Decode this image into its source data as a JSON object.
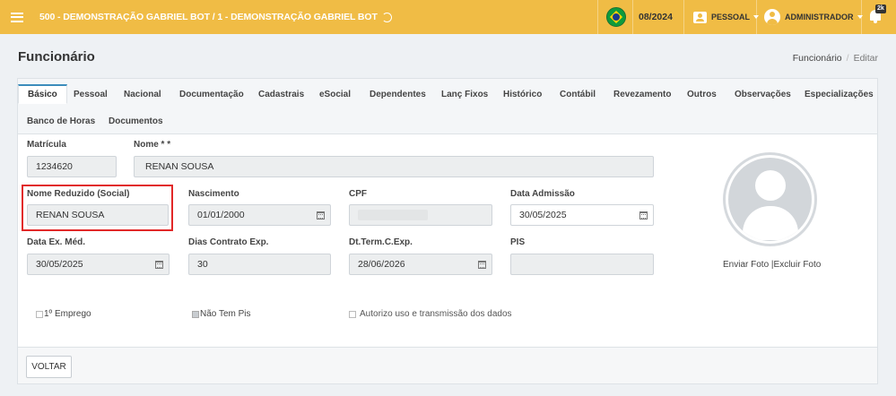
{
  "topbar": {
    "company": "500 - DEMONSTRAÇÃO GABRIEL BOT / 1 - DEMONSTRAÇÃO GABRIEL BOT",
    "period": "08/2024",
    "module": "PESSOAL",
    "user": "ADMINISTRADOR",
    "notification_badge": "2k",
    "color": "#f0bc45"
  },
  "page": {
    "title": "Funcionário",
    "breadcrumb": [
      "Funcionário",
      "Editar"
    ]
  },
  "tabs": {
    "active": "Básico",
    "row1": [
      "Básico",
      "Pessoal",
      "Nacional",
      "Documentação",
      "Cadastrais",
      "eSocial",
      "Dependentes",
      "Lanç Fixos",
      "Histórico",
      "Contábil",
      "Revezamento",
      "Outros",
      "Observações",
      "Especializações"
    ],
    "row2": [
      "Banco de Horas",
      "Documentos"
    ]
  },
  "form": {
    "matricula": {
      "label": "Matrícula",
      "value": "1234620"
    },
    "nome": {
      "label": "Nome * *",
      "value": "RENAN SOUSA"
    },
    "nome_reduzido": {
      "label": "Nome Reduzido (Social)",
      "value": "RENAN SOUSA"
    },
    "nascimento": {
      "label": "Nascimento",
      "value": "01/01/2000"
    },
    "cpf": {
      "label": "CPF",
      "value": ""
    },
    "data_admissao": {
      "label": "Data Admissão",
      "value": "30/05/2025"
    },
    "data_ex_med": {
      "label": "Data Ex. Méd.",
      "value": "30/05/2025"
    },
    "dias_contrato": {
      "label": "Dias Contrato Exp.",
      "value": "30"
    },
    "dt_term": {
      "label": "Dt.Term.C.Exp.",
      "value": "28/06/2026"
    },
    "pis": {
      "label": "PIS",
      "value": ""
    },
    "primeiro_emprego": {
      "label": "1º Emprego",
      "checked": false
    },
    "nao_tem_pis": {
      "label": "Não Tem Pis",
      "checked": true
    },
    "autorizo": {
      "label": "Autorizo uso e transmissão dos dados",
      "checked": false
    }
  },
  "photo": {
    "send": "Enviar Foto",
    "separator": "|",
    "delete": "Excluir Foto"
  },
  "footer": {
    "back_label": "VOLTAR"
  }
}
